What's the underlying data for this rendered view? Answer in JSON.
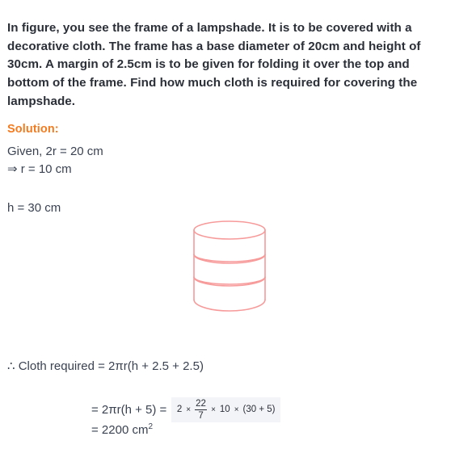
{
  "question": {
    "text": "In figure, you see the frame of a lampshade. It is to be covered with a decorative cloth. The frame has a base diameter of 20cm and height of 30cm. A margin of 2.5cm is to be given for folding it over the top and bottom of the frame. Find how much cloth is required for covering the lampshade."
  },
  "solution": {
    "heading": "Solution:",
    "given_line": "Given, 2r = 20 cm",
    "radius_line": "⇒ r = 10 cm",
    "height_line": "h = 30 cm",
    "cloth_line": "∴ Cloth required = 2πr(h + 2.5 + 2.5)",
    "formula_line": "= 2πr(h + 5) =",
    "final_line_prefix": "= 2200 cm",
    "final_line_exponent": "2"
  },
  "equation": {
    "coefficient": "2",
    "times_1": "×",
    "fraction_numerator": "22",
    "fraction_denominator": "7",
    "times_2": "×",
    "radius": "10",
    "times_3": "×",
    "bracket": "(30 + 5)"
  },
  "figure": {
    "name": "lampshade-frame-cylinder",
    "stroke_color": "#f79a9a",
    "fill_color": "#ffffff",
    "description": "Cylindrical lampshade frame drawn with a top ellipse and two horizontal ring bands"
  },
  "colors": {
    "question_text": "#2b2f38",
    "solution_heading": "#f47b20",
    "body_text": "#3a4252",
    "figure_stroke": "#f79a9a",
    "page_background": "#ffffff",
    "equation_background": "#f3f4f7"
  }
}
